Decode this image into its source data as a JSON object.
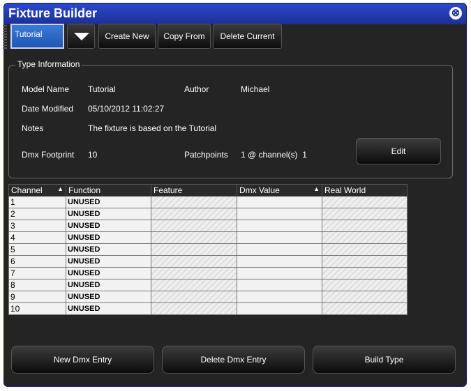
{
  "window": {
    "title": "Fixture Builder"
  },
  "toolbar": {
    "selected_type": "Tutorial",
    "create_new": "Create New",
    "copy_from": "Copy From",
    "delete_current": "Delete Current"
  },
  "type_info": {
    "group_title": "Type Information",
    "model_name_label": "Model Name",
    "model_name": "Tutorial",
    "author_label": "Author",
    "author": "Michael",
    "date_modified_label": "Date Modified",
    "date_modified": "05/10/2012 11:02:27",
    "notes_label": "Notes",
    "notes": "The fixture is based on the Tutorial",
    "dmx_footprint_label": "Dmx Footprint",
    "dmx_footprint": "10",
    "patchpoints_label": "Patchpoints",
    "patchpoints": "1 @ channel(s)  1",
    "edit_label": "Edit"
  },
  "table": {
    "columns": [
      "Channel",
      "Function",
      "Feature",
      "Dmx Value",
      "Real World"
    ],
    "rows": [
      {
        "channel": "1",
        "function": "UNUSED"
      },
      {
        "channel": "2",
        "function": "UNUSED"
      },
      {
        "channel": "3",
        "function": "UNUSED"
      },
      {
        "channel": "4",
        "function": "UNUSED"
      },
      {
        "channel": "5",
        "function": "UNUSED"
      },
      {
        "channel": "6",
        "function": "UNUSED"
      },
      {
        "channel": "7",
        "function": "UNUSED"
      },
      {
        "channel": "8",
        "function": "UNUSED"
      },
      {
        "channel": "9",
        "function": "UNUSED"
      },
      {
        "channel": "10",
        "function": "UNUSED"
      }
    ]
  },
  "buttons": {
    "new_dmx_entry": "New Dmx Entry",
    "delete_dmx_entry": "Delete Dmx Entry",
    "build_type": "Build Type"
  },
  "colors": {
    "title_bar": "#2b49c5",
    "panel": "#242424",
    "selected": "#3a7bd6"
  },
  "icons": {
    "close": "close-icon",
    "dropdown": "triangle-down-icon",
    "sort": "sort-ascending-icon"
  }
}
